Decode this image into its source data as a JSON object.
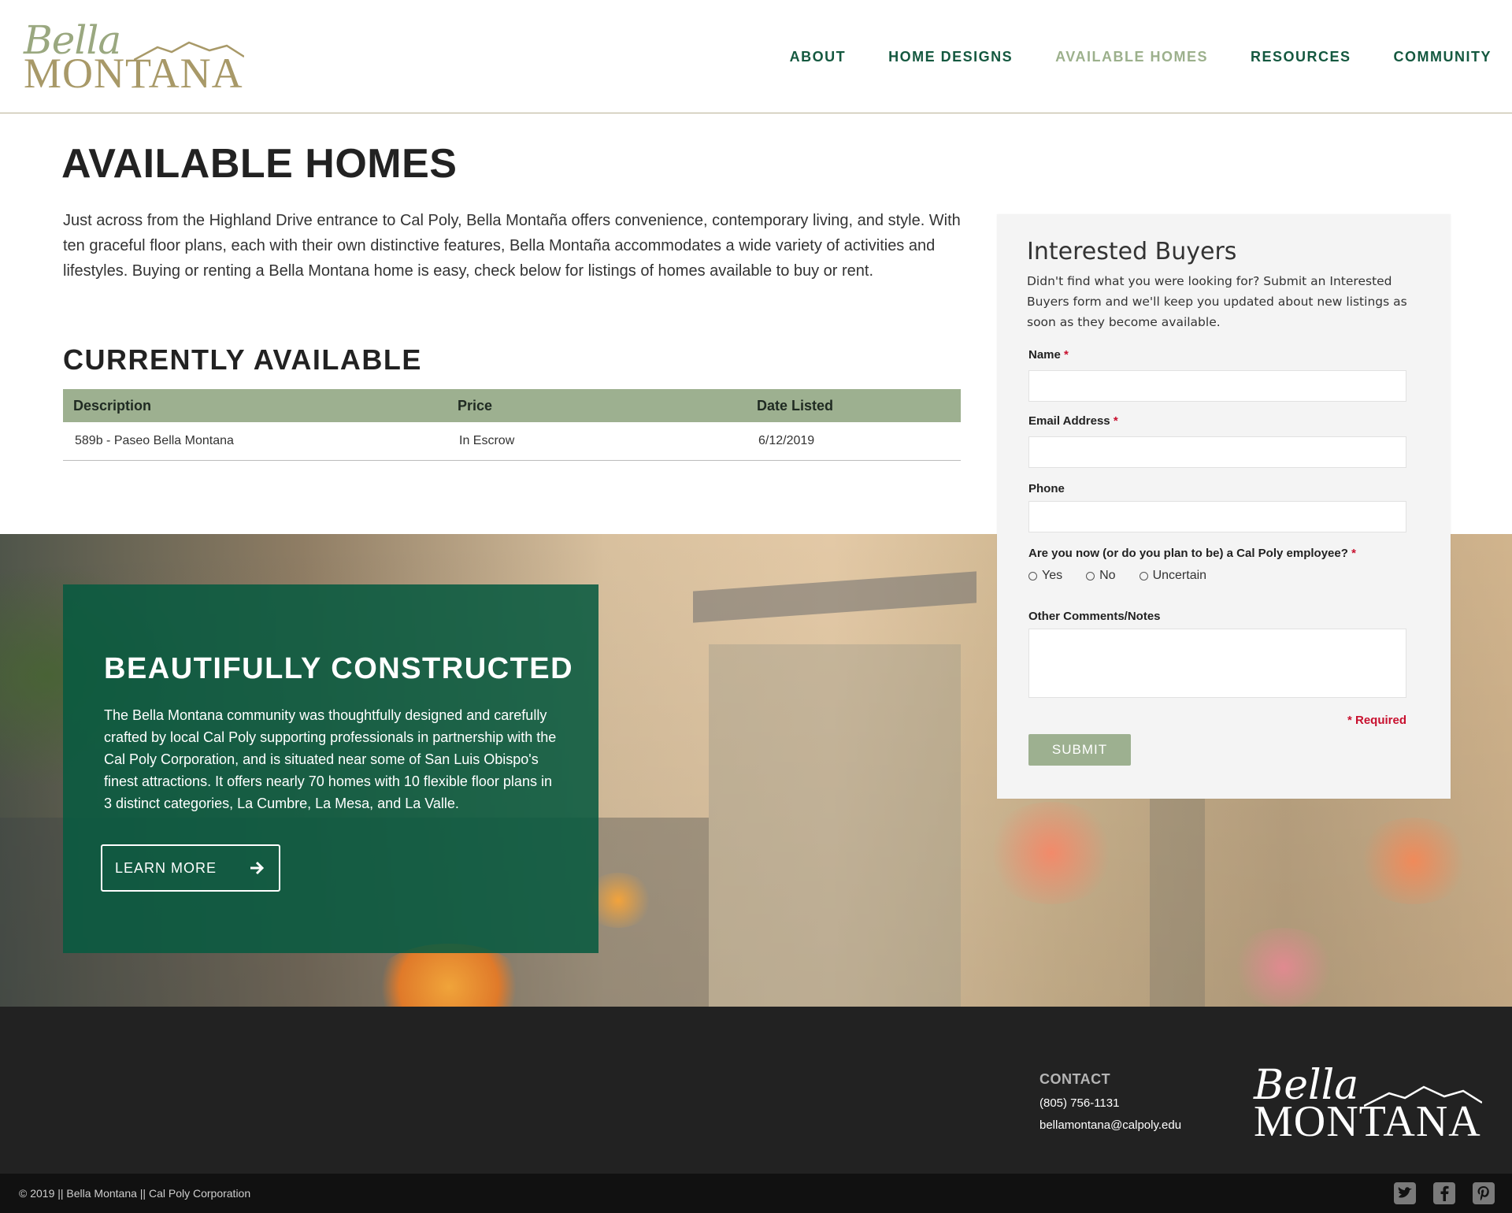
{
  "header": {
    "logo_script": "Bella",
    "logo_caps": "MONTANA",
    "nav": [
      {
        "label": "ABOUT"
      },
      {
        "label": "HOME DESIGNS"
      },
      {
        "label": "AVAILABLE HOMES"
      },
      {
        "label": "RESOURCES"
      },
      {
        "label": "COMMUNITY"
      }
    ]
  },
  "main": {
    "title": "AVAILABLE HOMES",
    "intro": "Just across from the Highland Drive entrance to Cal Poly, Bella Montaña offers convenience, contemporary living, and style. With ten graceful floor plans, each with their own distinctive features, Bella Montaña accommodates a wide variety of activities and lifestyles. Buying or renting a Bella Montana home is easy, check below for listings of homes available to buy or rent.",
    "section_title": "CURRENTLY AVAILABLE",
    "table": {
      "headers": [
        "Description",
        "Price",
        "Date Listed"
      ],
      "rows": [
        [
          "589b - Paseo Bella Montana",
          "In Escrow",
          "6/12/2019"
        ]
      ]
    }
  },
  "promo": {
    "title": "BEAUTIFULLY CONSTRUCTED",
    "text": "The Bella Montana community was thoughtfully designed and carefully crafted by local Cal Poly supporting professionals in partnership with the Cal Poly Corporation, and is situated near some of San Luis Obispo's finest attractions. It offers nearly 70 homes with 10 flexible floor plans in 3 distinct categories, La Cumbre, La Mesa, and La Valle.",
    "button_label": "LEARN MORE"
  },
  "form": {
    "title": "Interested Buyers",
    "description": "Didn't find what you were looking for? Submit an Interested Buyers form and we'll keep you updated about new listings as soon as they become available.",
    "name_label": "Name",
    "email_label": "Email Address",
    "phone_label": "Phone",
    "employee_question": "Are you now (or do you plan to be) a Cal Poly employee?",
    "radio_options": [
      "Yes",
      "No",
      "Uncertain"
    ],
    "comments_label": "Other Comments/Notes",
    "required_mark": "*",
    "required_note": "* Required",
    "submit_label": "SUBMIT"
  },
  "footer": {
    "contact_heading": "CONTACT",
    "phone": "(805) 756-1131",
    "email": "bellamontana@calpoly.edu",
    "logo_script": "Bella",
    "logo_caps": "MONTANA",
    "copyright": "© 2019 || Bella Montana || Cal Poly Corporation",
    "socials": [
      "twitter-icon",
      "facebook-icon",
      "pinterest-icon"
    ]
  },
  "colors": {
    "brand_green": "#14583f",
    "sage": "#9db090",
    "gold": "#a89968",
    "required_red": "#c8102e"
  }
}
